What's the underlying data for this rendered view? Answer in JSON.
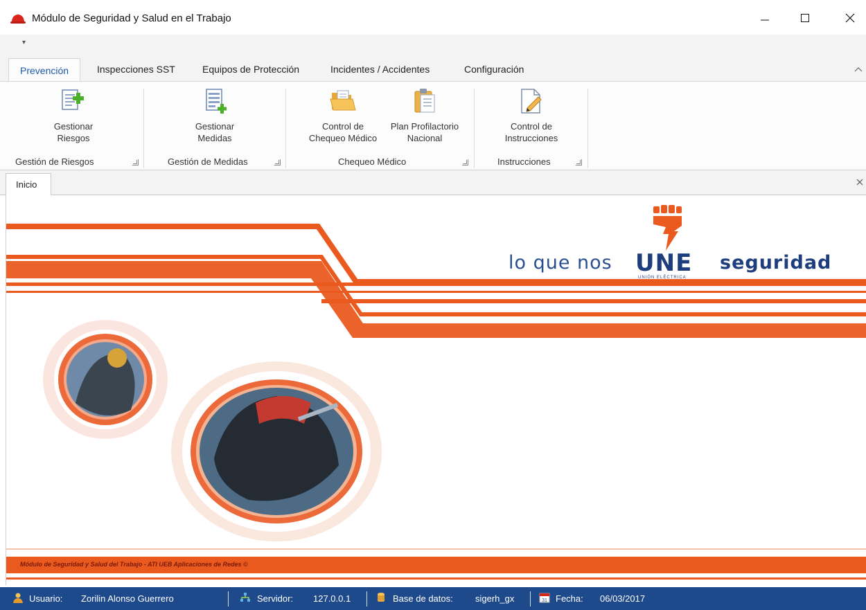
{
  "window": {
    "title": "Módulo de Seguridad y Salud en el Trabajo",
    "app_icon": "hard-hat-icon",
    "controls": [
      "minimize-icon",
      "maximize-icon",
      "close-icon"
    ]
  },
  "quick_access": {
    "menu_glyph": "▾"
  },
  "tabs": [
    {
      "label": "Prevención",
      "active": true
    },
    {
      "label": "Inspecciones SST"
    },
    {
      "label": "Equipos de Protección"
    },
    {
      "label": "Incidentes / Accidentes"
    },
    {
      "label": "Configuración"
    }
  ],
  "ribbon": {
    "groups": [
      {
        "label": "Gestión de Riesgos",
        "buttons": [
          {
            "line1": "Gestionar",
            "line2": "Riesgos",
            "icon": "document-add-icon"
          }
        ]
      },
      {
        "label": "Gestión de Medidas",
        "buttons": [
          {
            "line1": "Gestionar",
            "line2": "Medidas",
            "icon": "document-list-add-icon"
          }
        ]
      },
      {
        "label": "Chequeo Médico",
        "buttons": [
          {
            "line1": "Control de",
            "line2": "Chequeo Médico",
            "icon": "folder-open-icon"
          },
          {
            "line1": "Plan Profilactorio",
            "line2": "Nacional",
            "icon": "clipboard-icon"
          }
        ]
      },
      {
        "label": "Instrucciones",
        "buttons": [
          {
            "line1": "Control de",
            "line2": "Instrucciones",
            "icon": "edit-document-icon"
          }
        ]
      }
    ]
  },
  "document_tabs": [
    {
      "label": "Inicio"
    }
  ],
  "banner": {
    "slogan": "lo que nos",
    "brand": "UNE",
    "brand_sub": "UNIÓN ELÉCTRICA",
    "word": "seguridad",
    "footer": "Módulo de Seguridad y Salud del Trabajo - ATI UEB Aplicaciones de Redes ©",
    "colors": {
      "orange": "#ea5a1f",
      "navy": "#1d3d7c"
    }
  },
  "status": {
    "user_label": "Usuario:",
    "user_value": "Zorilin Alonso Guerrero",
    "server_label": "Servidor:",
    "server_value": "127.0.0.1",
    "db_label": "Base de datos:",
    "db_value": "sigerh_gx",
    "date_label": "Fecha:",
    "date_value": "06/03/2017",
    "date_icon_day": "31"
  }
}
